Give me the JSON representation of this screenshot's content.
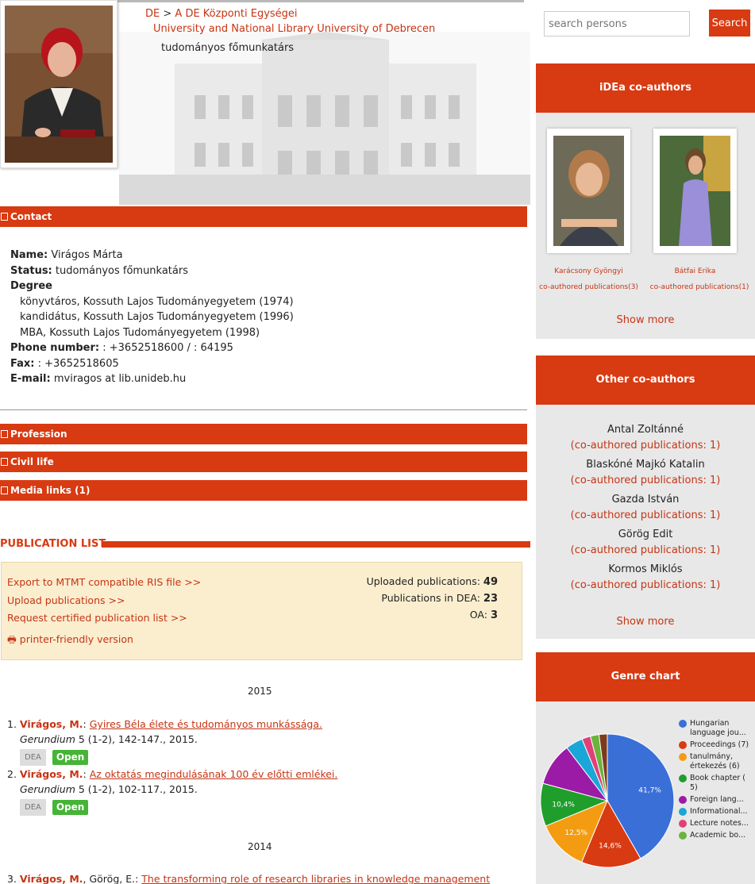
{
  "header": {
    "breadcrumb_part1": "DE",
    "breadcrumb_sep": ">",
    "breadcrumb_part2": "A DE Központi Egységei",
    "institution": "University and National Library University of Debrecen",
    "position": "tudományos főmunkatárs"
  },
  "sections": {
    "contact": "Contact",
    "profession": "Profession",
    "civil_life": "Civil life",
    "media_links": "Media links (1)"
  },
  "contact": {
    "name_label": "Name:",
    "name": "Virágos Márta",
    "status_label": "Status:",
    "status": "tudományos főmunkatárs",
    "degree_label": "Degree",
    "degrees": [
      "könyvtáros, Kossuth Lajos Tudományegyetem (1974)",
      "kandidátus, Kossuth Lajos Tudományegyetem (1996)",
      "MBA, Kossuth Lajos Tudományegyetem (1998)"
    ],
    "phone_label": "Phone number:",
    "phone": ": +3652518600 / : 64195",
    "fax_label": "Fax:",
    "fax": ": +3652518605",
    "email_label": "E-mail:",
    "email": "mviragos at lib.unideb.hu"
  },
  "publications": {
    "title": "PUBLICATION LIST",
    "export_link": "Export to MTMT compatible RIS file >>",
    "upload_link": "Upload publications >>",
    "certified_link": "Request certified publication list >>",
    "printer_link": "printer-friendly version",
    "uploaded_label": "Uploaded publications:",
    "uploaded_value": "49",
    "dea_label": "Publications in DEA:",
    "dea_value": "23",
    "oa_label": "OA:",
    "oa_value": "3",
    "year_2015": "2015",
    "year_2014": "2014",
    "items": [
      {
        "num": "1.",
        "author": "Virágos, M.",
        "sep": ":",
        "title": "Gyires Béla élete és tudományos munkássága.",
        "journal": "Gerundium",
        "details": "5 (1-2), 142-147., 2015.",
        "dea": "DEA",
        "open": "Open"
      },
      {
        "num": "2.",
        "author": "Virágos, M.",
        "sep": ":",
        "title": "Az oktatás megindulásának 100 év előtti emlékei.",
        "journal": "Gerundium",
        "details": "5 (1-2), 102-117., 2015.",
        "dea": "DEA",
        "open": "Open"
      },
      {
        "num": "3.",
        "author": "Virágos, M.",
        "coauthor": ", Görög, E.:",
        "title": "The transforming role of research libraries in knowledge management"
      }
    ]
  },
  "sidebar": {
    "search_placeholder": "search persons",
    "search_button": "Search",
    "idea_title": "iDEa co-authors",
    "idea_coauthors": [
      {
        "name": "Karácsony Gyöngyi",
        "link": "co-authored publications(3)"
      },
      {
        "name": "Bátfai Erika",
        "link": "co-authored publications(1)"
      }
    ],
    "show_more": "Show more",
    "other_title": "Other co-authors",
    "other_coauthors": [
      {
        "name": "Antal Zoltánné",
        "link": "(co-authored publications: 1)"
      },
      {
        "name": "Blaskóné Majkó Katalin",
        "link": "(co-authored publications: 1)"
      },
      {
        "name": "Gazda István",
        "link": "(co-authored publications: 1)"
      },
      {
        "name": "Görög Edit",
        "link": "(co-authored publications: 1)"
      },
      {
        "name": "Kormos Miklós",
        "link": "(co-authored publications: 1)"
      }
    ],
    "genre_title": "Genre chart"
  },
  "chart_data": {
    "type": "pie",
    "title": "Genre chart",
    "legend": [
      {
        "label": "Hungarian language jou...",
        "color": "#3a6fd8"
      },
      {
        "label": "Proceedings (7)",
        "color": "#d83a12"
      },
      {
        "label": "tanulmány, értekezés (6)",
        "color": "#f39c12"
      },
      {
        "label": "Book chapter ( 5)",
        "color": "#1f9e2c"
      },
      {
        "label": "Foreign lang...",
        "color": "#9b1ba6"
      },
      {
        "label": "Informational...",
        "color": "#1aa6d6"
      },
      {
        "label": "Lecture notes...",
        "color": "#e0407a"
      },
      {
        "label": "Academic bo...",
        "color": "#6cb33e"
      }
    ],
    "slices": [
      {
        "value": 41.7,
        "label": "41,7%",
        "color": "#3a6fd8"
      },
      {
        "value": 14.6,
        "label": "14,6%",
        "color": "#d83a12"
      },
      {
        "value": 12.5,
        "label": "12,5%",
        "color": "#f39c12"
      },
      {
        "value": 10.4,
        "label": "10,4%",
        "color": "#1f9e2c"
      },
      {
        "value": 10.4,
        "label": "",
        "color": "#9b1ba6"
      },
      {
        "value": 4.2,
        "label": "",
        "color": "#1aa6d6"
      },
      {
        "value": 2.1,
        "label": "",
        "color": "#e0407a"
      },
      {
        "value": 2.1,
        "label": "",
        "color": "#6cb33e"
      },
      {
        "value": 2.0,
        "label": "",
        "color": "#7a3b1e"
      }
    ]
  }
}
